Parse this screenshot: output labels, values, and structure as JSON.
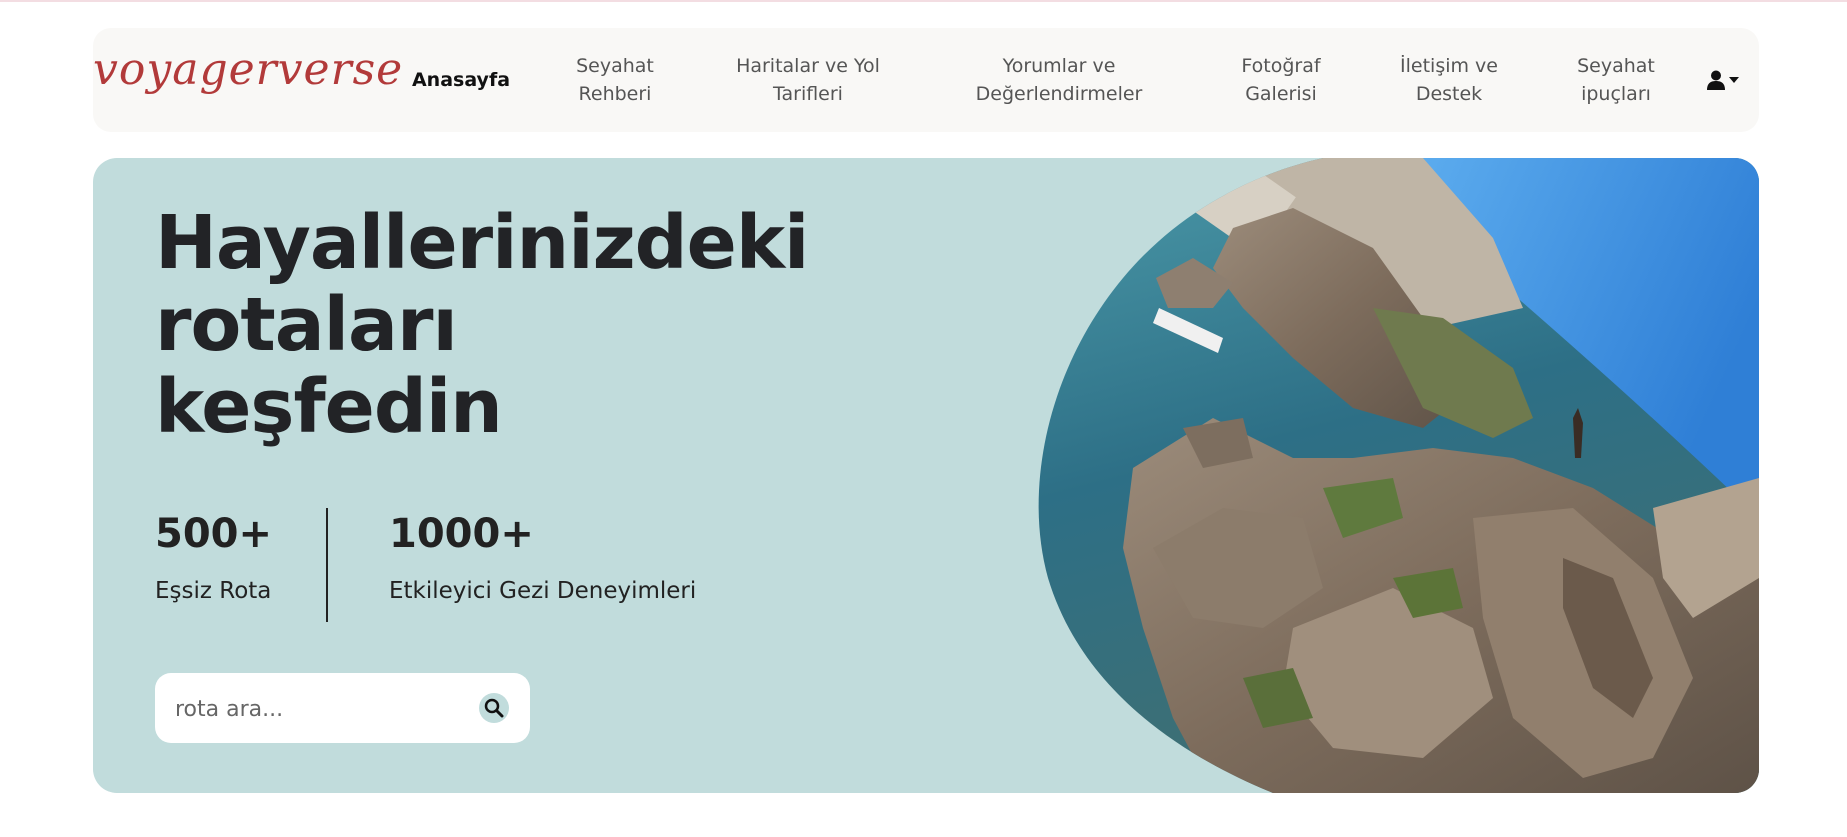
{
  "brand": {
    "logo_text": "voyagerverse",
    "logo_color": "#b23a3a"
  },
  "nav": {
    "items": [
      {
        "label_line1": "Anasayfa",
        "label_line2": "",
        "active": true
      },
      {
        "label_line1": "Seyahat",
        "label_line2": "Rehberi",
        "active": false
      },
      {
        "label_line1": "Haritalar ve Yol",
        "label_line2": "Tarifleri",
        "active": false
      },
      {
        "label_line1": "Yorumlar ve",
        "label_line2": "Değerlendirmeler",
        "active": false
      },
      {
        "label_line1": "Fotoğraf",
        "label_line2": "Galerisi",
        "active": false
      },
      {
        "label_line1": "İletişim ve",
        "label_line2": "Destek",
        "active": false
      },
      {
        "label_line1": "Seyahat",
        "label_line2": "ipuçları",
        "active": false
      }
    ],
    "user_icon": "user-icon",
    "dropdown_icon": "caret-down-icon"
  },
  "hero": {
    "title_line1": "Hayallerinizdeki",
    "title_line2": "rotaları",
    "title_line3": "keşfedin",
    "background_color": "#c1dcdc",
    "stats": [
      {
        "value": "500+",
        "label": "Eşsiz Rota"
      },
      {
        "value": "1000+",
        "label": "Etkileyici Gezi Deneyimleri"
      }
    ],
    "search": {
      "placeholder": "rota ara...",
      "value": "",
      "icon": "search-icon"
    },
    "image": {
      "alt": "coastal cliffs photo",
      "accent_shape_color": "#808080"
    }
  }
}
